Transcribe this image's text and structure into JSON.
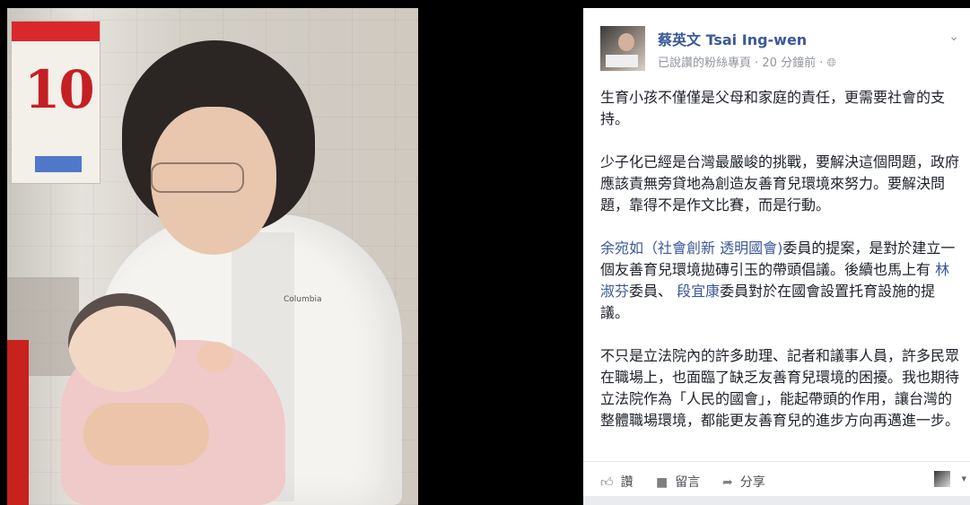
{
  "colors": {
    "link": "#3b5998",
    "meta": "#90949c",
    "text": "#1d2129"
  },
  "photo": {
    "calendar_number": "10",
    "jacket_logo": "Columbia"
  },
  "post": {
    "author": "蔡英文 Tsai Ing-wen",
    "meta": "已說讚的粉絲專頁 · 20 分鐘前 ·",
    "globe_icon": "globe-icon",
    "paragraphs": {
      "p1": "生育小孩不僅僅是父母和家庭的責任，更需要社會的支持。",
      "p2": "少子化已經是台灣最嚴峻的挑戰，要解決這個問題，政府應該責無旁貸地為創造友善育兒環境來努力。要解決問題，靠得不是作文比賽，而是行動。",
      "p3_link1": "余宛如（社會創新 透明國會)",
      "p3_text1": "委員的提案，是對於建立一個友善育兒環境拋磚引玉的帶頭倡議。後續也馬上有 ",
      "p3_link2": "林淑芬",
      "p3_text2": "委員、 ",
      "p3_link3": "段宜康",
      "p3_text3": "委員對於在國會設置托育設施的提議。",
      "p4": "不只是立法院內的許多助理、記者和議事人員，許多民眾在職場上，也面臨了缺乏友善育兒環境的困擾。我也期待立法院作為「人民的國會」，能起帶頭的作用，讓台灣的整體職場環境，都能更友善育兒的進步方向再邁進一步。"
    },
    "actions": {
      "like": "讚",
      "comment": "留言",
      "share": "分享"
    }
  }
}
